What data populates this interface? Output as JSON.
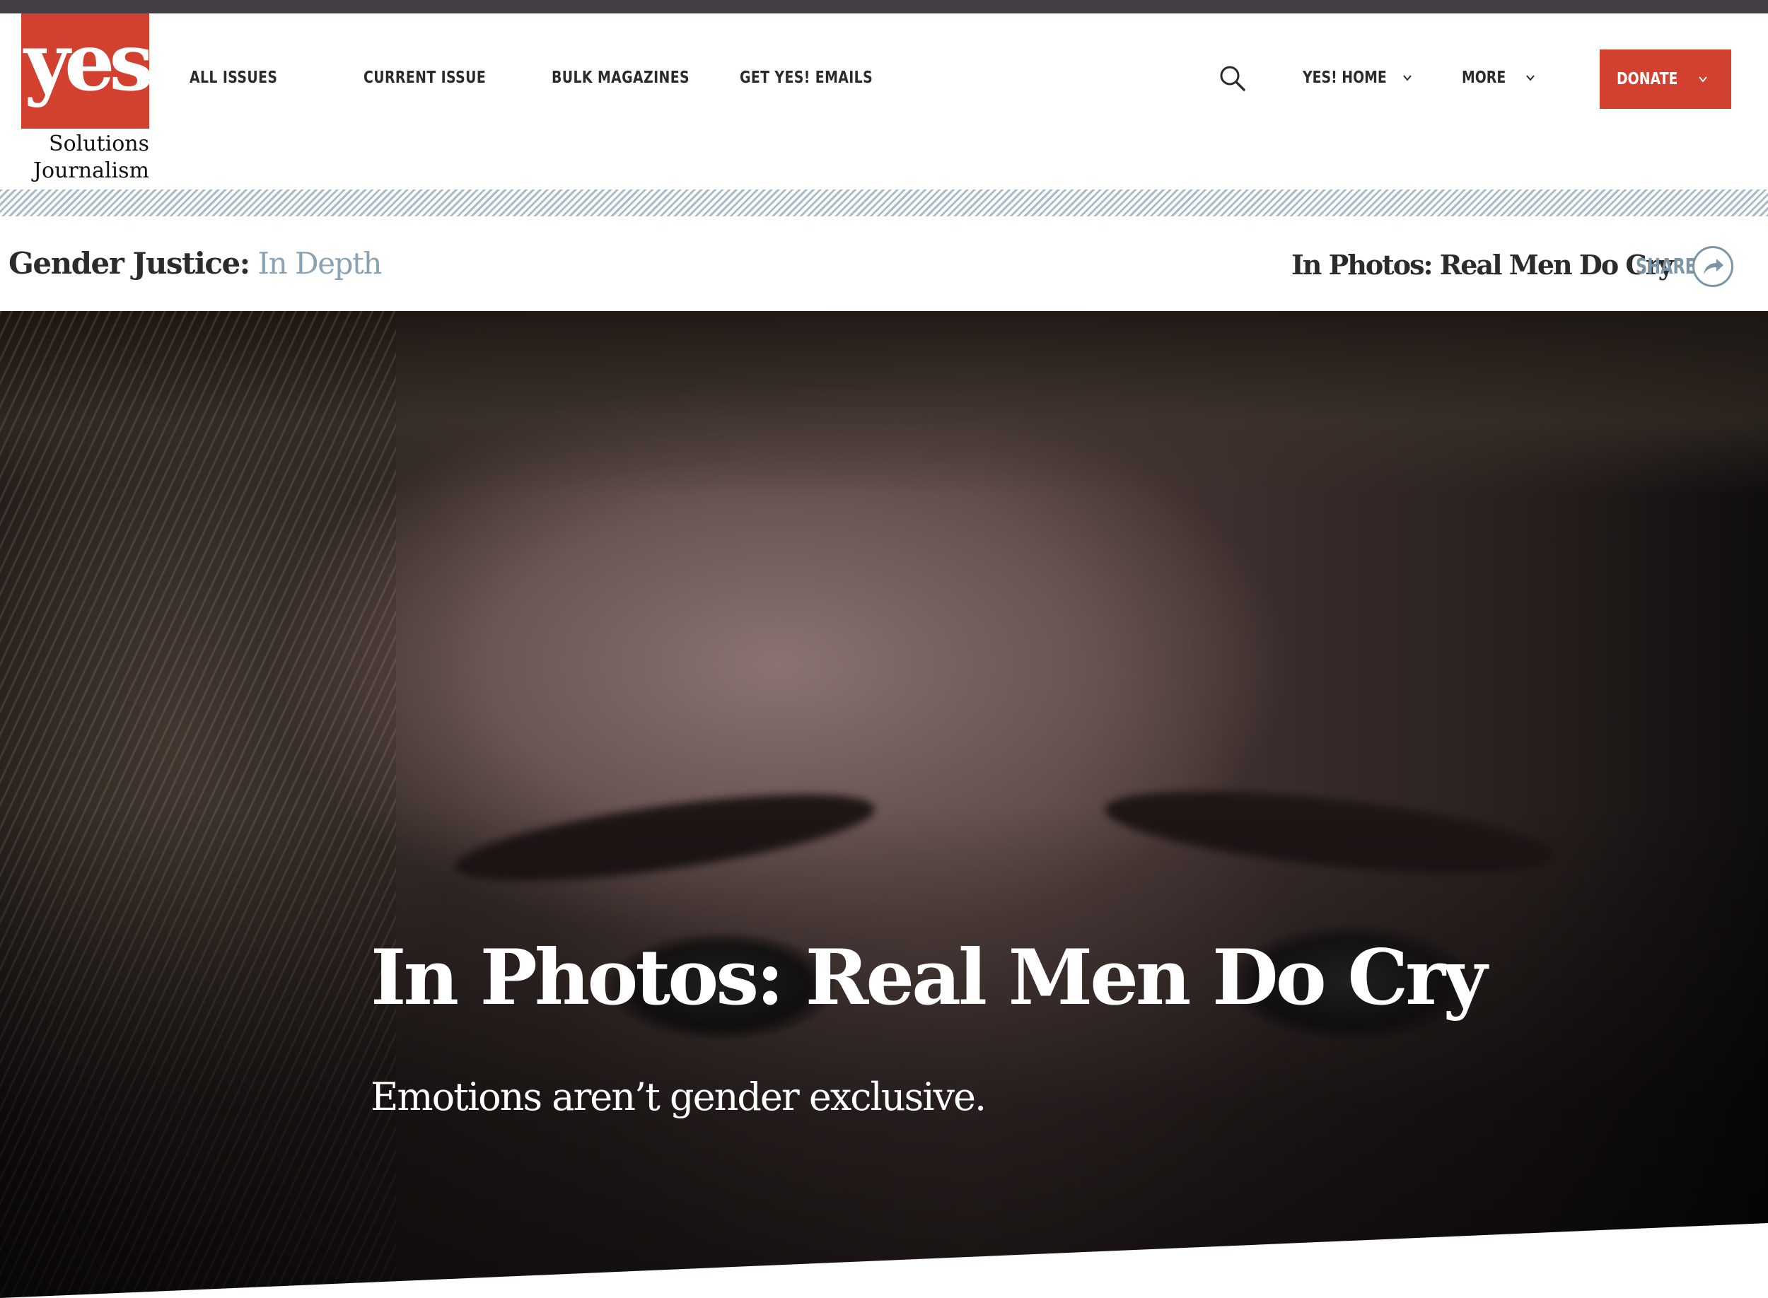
{
  "logo": {
    "wordmark": "yes!",
    "subtitle_line1": "Solutions",
    "subtitle_line2": "Journalism"
  },
  "nav": {
    "items": [
      {
        "label": "ALL ISSUES"
      },
      {
        "label": "CURRENT ISSUE"
      },
      {
        "label": "BULK MAGAZINES"
      },
      {
        "label": "GET YES! EMAILS"
      }
    ],
    "yes_home": "YES! HOME",
    "more": "MORE",
    "donate": "DONATE"
  },
  "section": {
    "title_strong": "Gender Justice:",
    "title_light": "In Depth",
    "article_title": "In Photos: Real Men Do Cry",
    "share_label": "SHARE"
  },
  "hero": {
    "title": "In Photos: Real Men Do Cry",
    "subtitle": "Emotions aren’t gender exclusive."
  },
  "colors": {
    "brand_red": "#d2412f",
    "accent_blue_gray": "#8aa2b2",
    "top_strip": "#443f45"
  },
  "icons": {
    "search": "search-icon",
    "chevron": "chevron-down-icon",
    "share": "share-arrow-icon"
  }
}
